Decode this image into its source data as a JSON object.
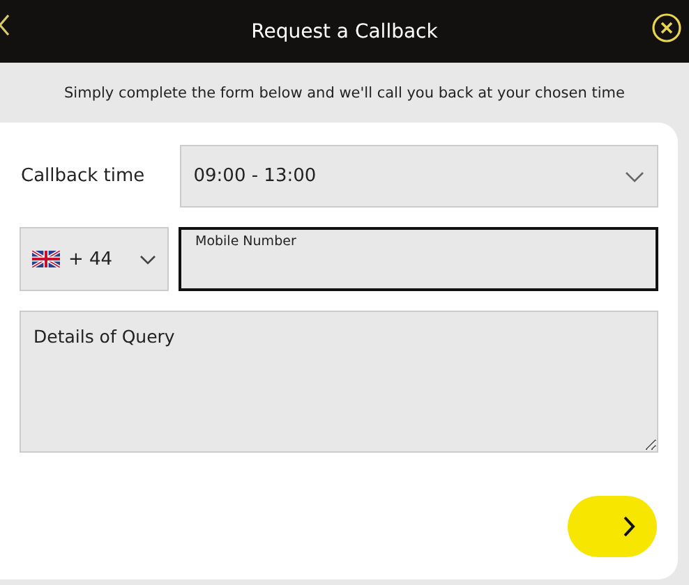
{
  "header": {
    "title": "Request a Callback"
  },
  "intro": "Simply complete the form below and we'll call you back at your chosen time",
  "callback_time": {
    "label": "Callback time",
    "value": "09:00 - 13:00"
  },
  "country_code": {
    "value": "+ 44"
  },
  "mobile_number": {
    "label": "Mobile Number",
    "focused": true
  },
  "details": {
    "placeholder": "Details of Query"
  }
}
